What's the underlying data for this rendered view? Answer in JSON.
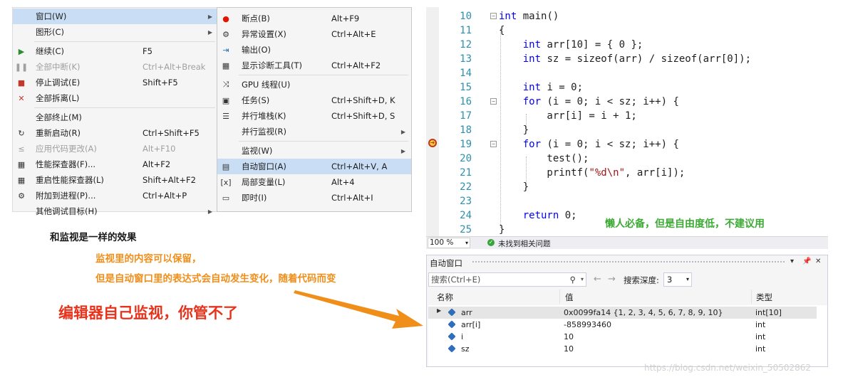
{
  "debug_menu": {
    "items": [
      {
        "label": "窗口(W)",
        "shortcut": "",
        "icon": "",
        "submenu": true,
        "highlight": true,
        "disabled": false
      },
      {
        "label": "图形(C)",
        "shortcut": "",
        "icon": "",
        "submenu": true,
        "highlight": false,
        "disabled": false
      },
      {
        "label": "继续(C)",
        "shortcut": "F5",
        "icon": "play-icon",
        "submenu": false,
        "highlight": false,
        "disabled": false
      },
      {
        "label": "全部中断(K)",
        "shortcut": "Ctrl+Alt+Break",
        "icon": "pause-icon",
        "submenu": false,
        "highlight": false,
        "disabled": true
      },
      {
        "label": "停止调试(E)",
        "shortcut": "Shift+F5",
        "icon": "stop-icon",
        "submenu": false,
        "highlight": false,
        "disabled": false
      },
      {
        "label": "全部拆离(L)",
        "shortcut": "",
        "icon": "detach-icon",
        "submenu": false,
        "highlight": false,
        "disabled": false
      },
      {
        "label": "全部终止(M)",
        "shortcut": "",
        "icon": "",
        "submenu": false,
        "highlight": false,
        "disabled": false
      },
      {
        "label": "重新启动(R)",
        "shortcut": "Ctrl+Shift+F5",
        "icon": "restart-icon",
        "submenu": false,
        "highlight": false,
        "disabled": false
      },
      {
        "label": "应用代码更改(A)",
        "shortcut": "Alt+F10",
        "icon": "apply-code-icon",
        "submenu": false,
        "highlight": false,
        "disabled": true
      },
      {
        "label": "性能探查器(F)...",
        "shortcut": "Alt+F2",
        "icon": "profiler-icon",
        "submenu": false,
        "highlight": false,
        "disabled": false
      },
      {
        "label": "重启性能探查器(L)",
        "shortcut": "Shift+Alt+F2",
        "icon": "profiler-icon",
        "submenu": false,
        "highlight": false,
        "disabled": false
      },
      {
        "label": "附加到进程(P)...",
        "shortcut": "Ctrl+Alt+P",
        "icon": "attach-icon",
        "submenu": false,
        "highlight": false,
        "disabled": false
      },
      {
        "label": "其他调试目标(H)",
        "shortcut": "",
        "icon": "",
        "submenu": true,
        "highlight": false,
        "disabled": false
      }
    ]
  },
  "window_submenu": {
    "items": [
      {
        "label": "断点(B)",
        "shortcut": "Alt+F9",
        "icon": "breakpoint-icon",
        "submenu": false,
        "highlight": false
      },
      {
        "label": "异常设置(X)",
        "shortcut": "Ctrl+Alt+E",
        "icon": "exception-icon",
        "submenu": false,
        "highlight": false
      },
      {
        "label": "输出(O)",
        "shortcut": "",
        "icon": "output-icon",
        "submenu": false,
        "highlight": false
      },
      {
        "label": "显示诊断工具(T)",
        "shortcut": "Ctrl+Alt+F2",
        "icon": "diagnostics-icon",
        "submenu": false,
        "highlight": false
      },
      {
        "label": "GPU 线程(U)",
        "shortcut": "",
        "icon": "gpu-threads-icon",
        "submenu": false,
        "highlight": false
      },
      {
        "label": "任务(S)",
        "shortcut": "Ctrl+Shift+D, K",
        "icon": "tasks-icon",
        "submenu": false,
        "highlight": false
      },
      {
        "label": "并行堆栈(K)",
        "shortcut": "Ctrl+Shift+D, S",
        "icon": "parallel-stacks-icon",
        "submenu": false,
        "highlight": false
      },
      {
        "label": "并行监视(R)",
        "shortcut": "",
        "icon": "",
        "submenu": true,
        "highlight": false
      },
      {
        "label": "监视(W)",
        "shortcut": "",
        "icon": "",
        "submenu": true,
        "highlight": false
      },
      {
        "label": "自动窗口(A)",
        "shortcut": "Ctrl+Alt+V, A",
        "icon": "autos-icon",
        "submenu": false,
        "highlight": true
      },
      {
        "label": "局部变量(L)",
        "shortcut": "Alt+4",
        "icon": "locals-icon",
        "submenu": false,
        "highlight": false
      },
      {
        "label": "即时(I)",
        "shortcut": "Ctrl+Alt+I",
        "icon": "immediate-icon",
        "submenu": false,
        "highlight": false
      }
    ]
  },
  "editor": {
    "lines": [
      {
        "n": "10",
        "code": "int main()"
      },
      {
        "n": "11",
        "code": "{"
      },
      {
        "n": "12",
        "code": "    int arr[10] = { 0 };"
      },
      {
        "n": "13",
        "code": "    int sz = sizeof(arr) / sizeof(arr[0]);"
      },
      {
        "n": "14",
        "code": ""
      },
      {
        "n": "15",
        "code": "    int i = 0;"
      },
      {
        "n": "16",
        "code": "    for (i = 0; i < sz; i++) {"
      },
      {
        "n": "17",
        "code": "        arr[i] = i + 1;"
      },
      {
        "n": "18",
        "code": "    }"
      },
      {
        "n": "19",
        "code": "    for (i = 0; i < sz; i++) {"
      },
      {
        "n": "20",
        "code": "        test();"
      },
      {
        "n": "21",
        "code": "        printf(\"%d\\n\", arr[i]);"
      },
      {
        "n": "22",
        "code": "    }"
      },
      {
        "n": "23",
        "code": ""
      },
      {
        "n": "24",
        "code": "    return 0;"
      },
      {
        "n": "25",
        "code": "}"
      }
    ],
    "zoom": "100 %",
    "status_message": "未找到相关问题"
  },
  "autos_window": {
    "title": "自动窗口",
    "search_placeholder": "搜索(Ctrl+E)",
    "search_depth_label": "搜索深度:",
    "search_depth_value": "3",
    "columns": [
      "名称",
      "值",
      "类型"
    ],
    "rows": [
      {
        "name": "arr",
        "value": "0x0099fa14 {1, 2, 3, 4, 5, 6, 7, 8, 9, 10}",
        "type": "int[10]",
        "expandable": true
      },
      {
        "name": "arr[i]",
        "value": "-858993460",
        "type": "int",
        "expandable": false
      },
      {
        "name": "i",
        "value": "10",
        "type": "int",
        "expandable": false
      },
      {
        "name": "sz",
        "value": "10",
        "type": "int",
        "expandable": false
      }
    ]
  },
  "annotations": {
    "same_as_watch": "和监视是一样的效果",
    "orange_line1": "监视里的内容可以保留，",
    "orange_line2": "但是自动窗口里的表达式会自动发生变化，随着代码而变",
    "red": "编辑器自己监视，你管不了",
    "green": "懒人必备，但是自由度低，不建议用",
    "watermark": "https://blog.csdn.net/weixin_50502862"
  },
  "colors": {
    "menu_highlight": "#c9def5",
    "keyword": "#0000ff",
    "string": "#a31515",
    "line_number": "#2b91af",
    "annotation_orange": "#f08e1a",
    "annotation_red": "#e8321b",
    "annotation_green": "#3daa35",
    "arrow": "#f08e1a"
  }
}
